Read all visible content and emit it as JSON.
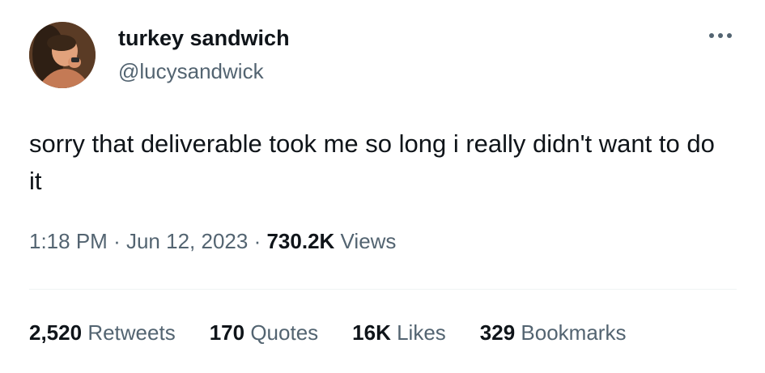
{
  "author": {
    "name": "turkey sandwich",
    "handle": "@lucysandwick"
  },
  "tweet": {
    "text": "sorry that deliverable took me so long i really didn't want to do it",
    "time": "1:18 PM",
    "separator": "·",
    "date": "Jun 12, 2023",
    "views_count": "730.2K",
    "views_label": "Views"
  },
  "stats": {
    "retweets": {
      "count": "2,520",
      "label": "Retweets"
    },
    "quotes": {
      "count": "170",
      "label": "Quotes"
    },
    "likes": {
      "count": "16K",
      "label": "Likes"
    },
    "bookmarks": {
      "count": "329",
      "label": "Bookmarks"
    }
  },
  "icons": {
    "more": "more-horizontal-icon",
    "avatar": "user-avatar"
  },
  "colors": {
    "text_primary": "#0f1419",
    "text_secondary": "#536471",
    "divider": "#eff3f4"
  }
}
